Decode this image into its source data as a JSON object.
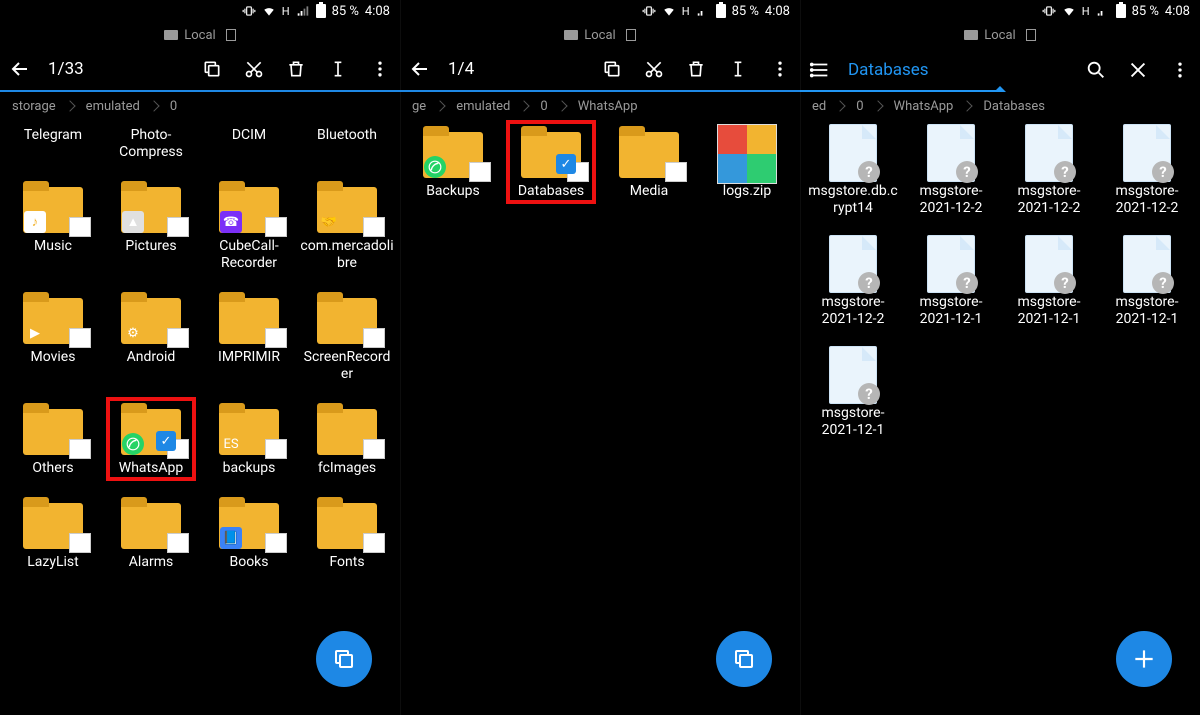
{
  "status": {
    "battery": "85 %",
    "time": "4:08",
    "net": "H"
  },
  "tab_label": "Local",
  "panes": [
    {
      "counter": "1/33",
      "breadcrumb": [
        "storage",
        "emulated",
        "0"
      ],
      "items": [
        {
          "label": "Telegram",
          "kind": "folder",
          "truncated": true,
          "no_icon": true
        },
        {
          "label": "Photo-Compress",
          "kind": "folder",
          "truncated": true,
          "no_icon": true
        },
        {
          "label": "DCIM",
          "kind": "folder",
          "truncated": true,
          "no_icon": true
        },
        {
          "label": "Bluetooth",
          "kind": "folder",
          "truncated": true,
          "no_icon": true
        },
        {
          "label": "Music",
          "kind": "folder",
          "badge": "note"
        },
        {
          "label": "Pictures",
          "kind": "folder",
          "badge": "pic"
        },
        {
          "label": "CubeCall-Recorder",
          "kind": "folder",
          "badge": "call"
        },
        {
          "label": "com.mercadolibre",
          "kind": "folder",
          "badge": "hand"
        },
        {
          "label": "Movies",
          "kind": "folder",
          "badge": "play"
        },
        {
          "label": "Android",
          "kind": "folder",
          "badge": "and"
        },
        {
          "label": "IMPRIMIR",
          "kind": "folder"
        },
        {
          "label": "ScreenRecorder",
          "kind": "folder"
        },
        {
          "label": "Others",
          "kind": "folder"
        },
        {
          "label": "WhatsApp",
          "kind": "folder",
          "badge": "green",
          "check": true,
          "highlight": true
        },
        {
          "label": "backups",
          "kind": "folder",
          "badge": "es"
        },
        {
          "label": "fcImages",
          "kind": "folder"
        },
        {
          "label": "LazyList",
          "kind": "folder"
        },
        {
          "label": "Alarms",
          "kind": "folder"
        },
        {
          "label": "Books",
          "kind": "folder",
          "badge": "book"
        },
        {
          "label": "Fonts",
          "kind": "folder",
          "fab_over": true
        }
      ],
      "fab": "copy"
    },
    {
      "counter": "1/4",
      "breadcrumb": [
        "ge",
        "emulated",
        "0",
        "WhatsApp"
      ],
      "items": [
        {
          "label": "Backups",
          "kind": "folder",
          "badge": "green"
        },
        {
          "label": "Databases",
          "kind": "folder",
          "check": true,
          "highlight": true
        },
        {
          "label": "Media",
          "kind": "folder"
        },
        {
          "label": "logs.zip",
          "kind": "zip"
        }
      ],
      "fab": "copy"
    },
    {
      "title": "Databases",
      "breadcrumb": [
        "ed",
        "0",
        "WhatsApp",
        "Databases"
      ],
      "items": [
        {
          "label": "msgstore.db.crypt14",
          "kind": "file"
        },
        {
          "label": "msgstore-2021-12-2",
          "kind": "file"
        },
        {
          "label": "msgstore-2021-12-2",
          "kind": "file"
        },
        {
          "label": "msgstore-2021-12-2",
          "kind": "file"
        },
        {
          "label": "msgstore-2021-12-2",
          "kind": "file"
        },
        {
          "label": "msgstore-2021-12-1",
          "kind": "file"
        },
        {
          "label": "msgstore-2021-12-1",
          "kind": "file"
        },
        {
          "label": "msgstore-2021-12-1",
          "kind": "file"
        },
        {
          "label": "msgstore-2021-12-1",
          "kind": "file"
        }
      ],
      "fab": "plus"
    }
  ]
}
